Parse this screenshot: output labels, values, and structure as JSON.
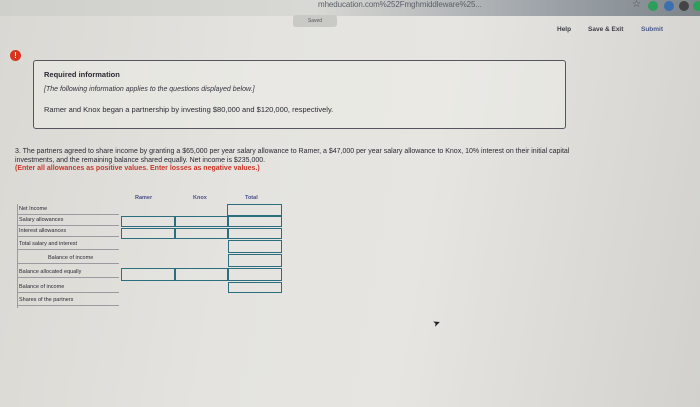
{
  "browser": {
    "url": "mheducation.com%252Fmghmiddleware%25..."
  },
  "header": {
    "saved_label": "Saved",
    "help_label": "Help",
    "save_exit_label": "Save & Exit",
    "submit_label": "Submit"
  },
  "info": {
    "title": "Required information",
    "note": "[The following information applies to the questions displayed below.]",
    "text": "Ramer and Knox began a partnership by investing $80,000 and $120,000, respectively."
  },
  "question": {
    "text": "3. The partners agreed to share income by granting a $65,000 per year salary allowance to Ramer, a $47,000 per year salary allowance to Knox, 10% interest on their initial capital investments, and the remaining balance shared equally. Net income is $235,000.",
    "instruction": "(Enter all allowances as positive values. Enter losses as negative values.)"
  },
  "table": {
    "columns": [
      "Ramer",
      "Knox",
      "Total"
    ],
    "rows": [
      {
        "label": "Net Income",
        "indent": false
      },
      {
        "label": "Salary allowances",
        "indent": false
      },
      {
        "label": "Interest allowances",
        "indent": false
      },
      {
        "label": "Total salary and interest",
        "indent": false
      },
      {
        "label": "Balance of income",
        "indent": true
      },
      {
        "label": "Balance allocated equally",
        "indent": false
      },
      {
        "label": "Balance of income",
        "indent": false
      },
      {
        "label": "Shares of the partners",
        "indent": false
      }
    ]
  },
  "colors": {
    "alert": "#d8331f",
    "instruction": "#c8372a",
    "input_border": "#2d6e7e"
  }
}
